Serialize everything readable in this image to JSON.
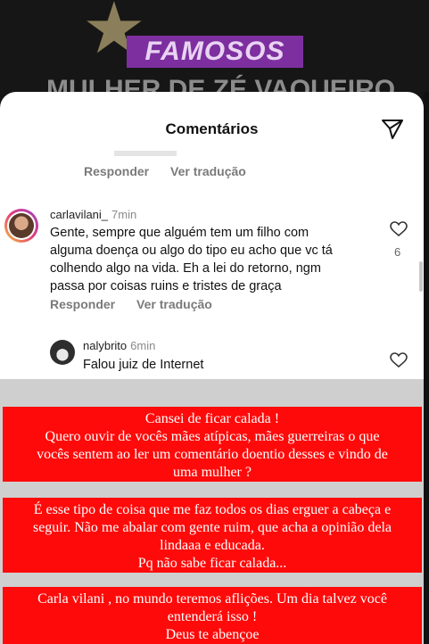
{
  "background": {
    "badge_label": "FAMOSOS",
    "headline": "MULHER DE ZÉ VAQUEIRO",
    "star_icon": "star-icon"
  },
  "sheet": {
    "title": "Comentários",
    "send_icon": "paper-plane-icon",
    "prev_comment": {
      "reply_label": "Responder",
      "translate_label": "Ver tradução"
    },
    "comments": [
      {
        "username": "carlavilani_",
        "time": "7min",
        "text_lines": [
          "Gente, sempre que alguém tem um filho com",
          "alguma doença ou algo do tipo eu acho que vc tá",
          "colhendo algo na vida. Eh a lei do retorno, ngm",
          "passa por coisas ruins e tristes de graça"
        ],
        "likes": "6",
        "reply_label": "Responder",
        "translate_label": "Ver tradução"
      },
      {
        "username": "nalybrito",
        "time": "6min",
        "text": "Falou juiz de Internet"
      }
    ]
  },
  "story_text": {
    "box1_lines": [
      "Cansei de ficar calada !",
      "Quero ouvir de vocês mães atípicas, mães guerreiras o que",
      "vocês sentem ao ler um comentário doentio desses e vindo de",
      "uma mulher ?"
    ],
    "box2_lines": [
      "É  esse tipo de coisa  que me faz todos os dias erguer a cabeça e",
      "seguir. Não me abalar com gente ruim, que acha a opinião dela",
      "lindaaa e educada.",
      "Pq não sabe ficar calada..."
    ],
    "box3_lines": [
      "Carla vilani , no mundo teremos aflições. Um dia talvez você",
      "entenderá isso !",
      "Deus te abençoe"
    ]
  },
  "colors": {
    "story_red": "#ff0a0a",
    "badge_purple": "#7d2fa0"
  }
}
